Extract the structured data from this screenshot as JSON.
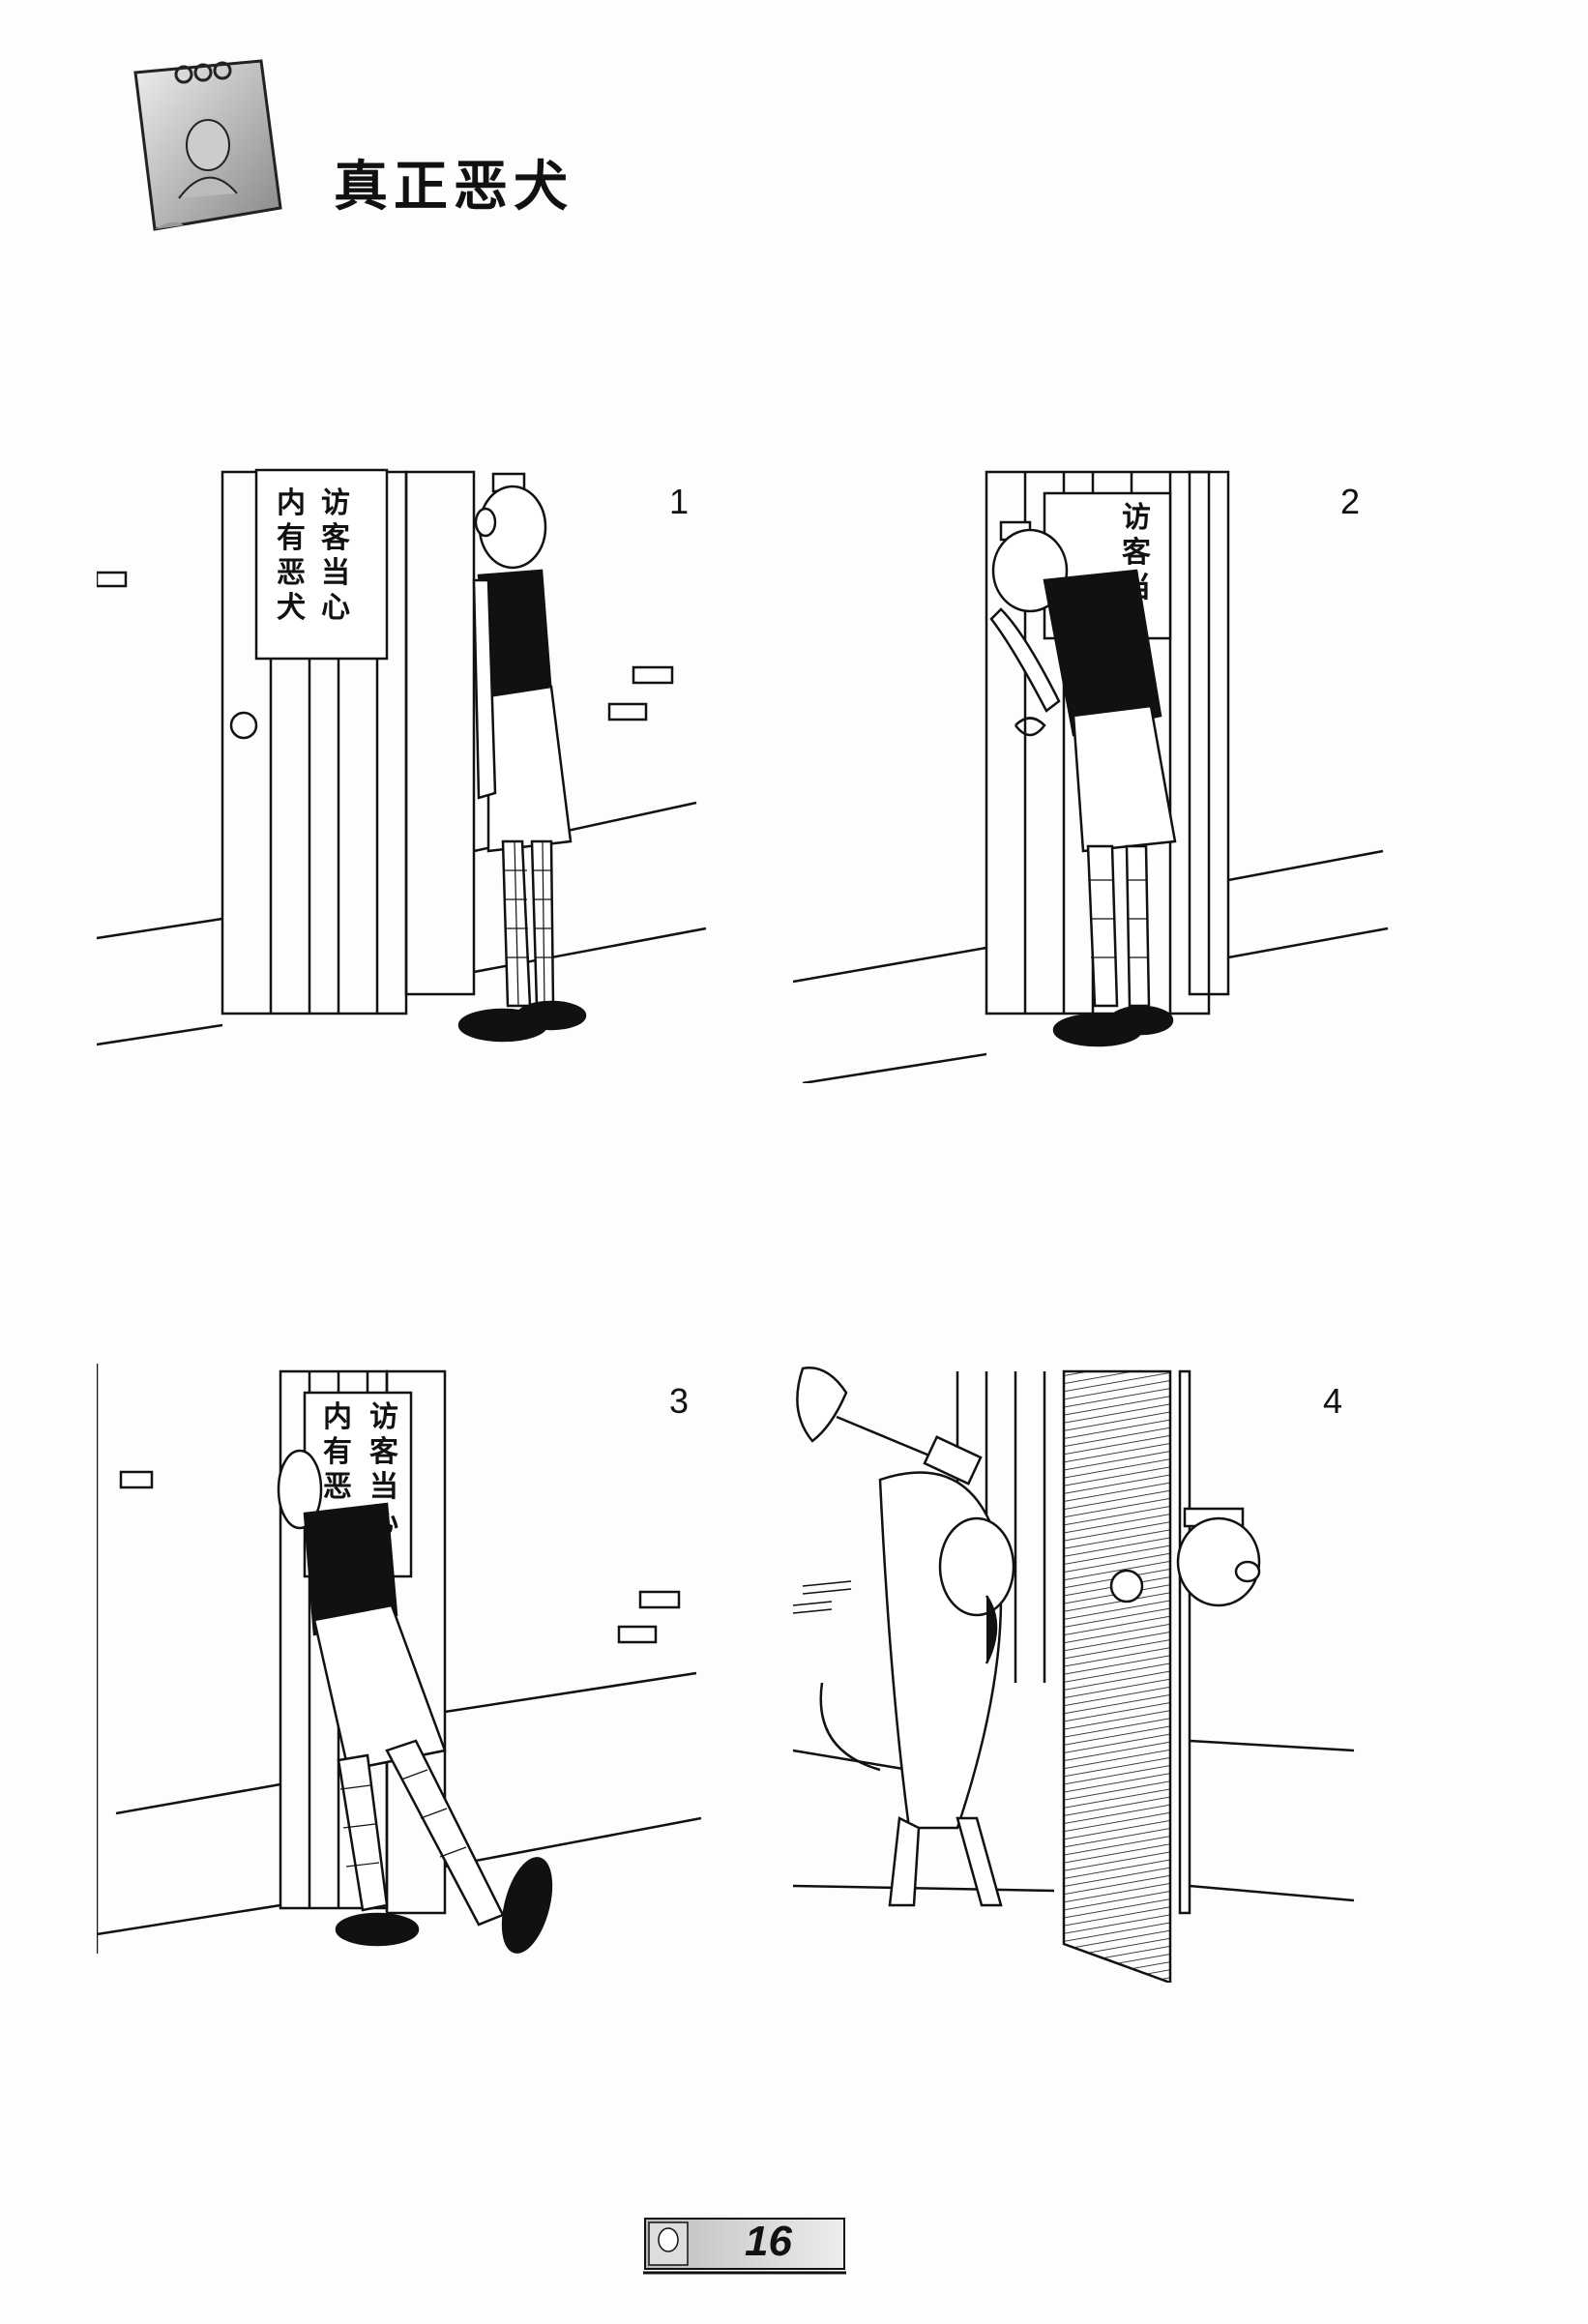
{
  "title": "真正恶犬",
  "panels": [
    {
      "number": "1",
      "sign": [
        "访客当心",
        "内有恶犬"
      ]
    },
    {
      "number": "2",
      "sign": [
        "访客当",
        ""
      ]
    },
    {
      "number": "3",
      "sign": [
        "访客当心",
        "内有恶"
      ]
    },
    {
      "number": "4"
    }
  ],
  "page_number": "16",
  "colors": {
    "ink": "#111111",
    "paper": "#fdfdfb"
  }
}
